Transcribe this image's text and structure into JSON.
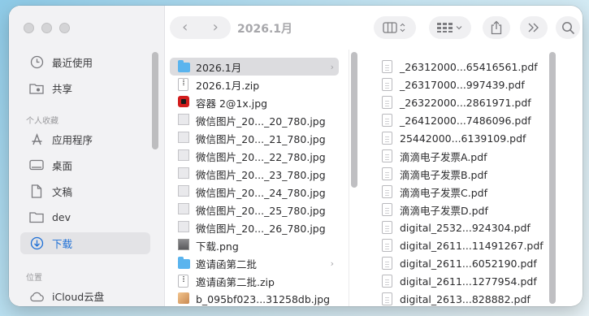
{
  "toolbar": {
    "back_glyph": "‹",
    "forward_glyph": "›",
    "title": "2026.1月",
    "view_glyph": "⊟ ⌃",
    "group_glyph": "⋮⋮⋮ ⌄",
    "share_glyph": "⇪",
    "more_glyph": "»",
    "search_glyph": "⌕"
  },
  "sidebar": {
    "favorites": [
      {
        "label": "最近使用",
        "icon": "clock-icon"
      },
      {
        "label": "共享",
        "icon": "shared-folder-icon"
      }
    ],
    "section_personal": "个人收藏",
    "personal": [
      {
        "label": "应用程序",
        "icon": "applications-icon"
      },
      {
        "label": "桌面",
        "icon": "desktop-icon"
      },
      {
        "label": "文稿",
        "icon": "document-icon"
      },
      {
        "label": "dev",
        "icon": "folder-icon"
      },
      {
        "label": "下载",
        "icon": "download-icon"
      }
    ],
    "section_location": "位置",
    "location": [
      {
        "label": "iCloud云盘",
        "icon": "cloud-icon"
      }
    ]
  },
  "column1": [
    {
      "name": "2026.1月",
      "type": "folder"
    },
    {
      "name": "2026.1月.zip",
      "type": "zip"
    },
    {
      "name": "容器 2@1x.jpg",
      "type": "red"
    },
    {
      "name": "微信图片_20..._20_780.jpg",
      "type": "image"
    },
    {
      "name": "微信图片_20..._21_780.jpg",
      "type": "image"
    },
    {
      "name": "微信图片_20..._22_780.jpg",
      "type": "image"
    },
    {
      "name": "微信图片_20..._23_780.jpg",
      "type": "image"
    },
    {
      "name": "微信图片_20..._24_780.jpg",
      "type": "image"
    },
    {
      "name": "微信图片_20..._25_780.jpg",
      "type": "image"
    },
    {
      "name": "微信图片_20..._26_780.jpg",
      "type": "image"
    },
    {
      "name": "下载.png",
      "type": "png"
    },
    {
      "name": "邀请函第二批",
      "type": "folder"
    },
    {
      "name": "邀请函第二批.zip",
      "type": "zip"
    },
    {
      "name": "b_095bf023...31258db.jpg",
      "type": "cat"
    }
  ],
  "column2": [
    "_26312000...65416561.pdf",
    "_26317000...997439.pdf",
    "_26322000...2861971.pdf",
    "_26412000...7486096.pdf",
    "25442000...6139109.pdf",
    "滴滴电子发票A.pdf",
    "滴滴电子发票B.pdf",
    "滴滴电子发票C.pdf",
    "滴滴电子发票D.pdf",
    "digital_2532...924304.pdf",
    "digital_2611...11491267.pdf",
    "digital_2611...6052190.pdf",
    "digital_2611...1277954.pdf",
    "digital_2613...828882.pdf"
  ],
  "colors": {
    "accent": "#1d6fd6",
    "folder": "#5ab4ee",
    "selection": "#dcdcdf"
  }
}
